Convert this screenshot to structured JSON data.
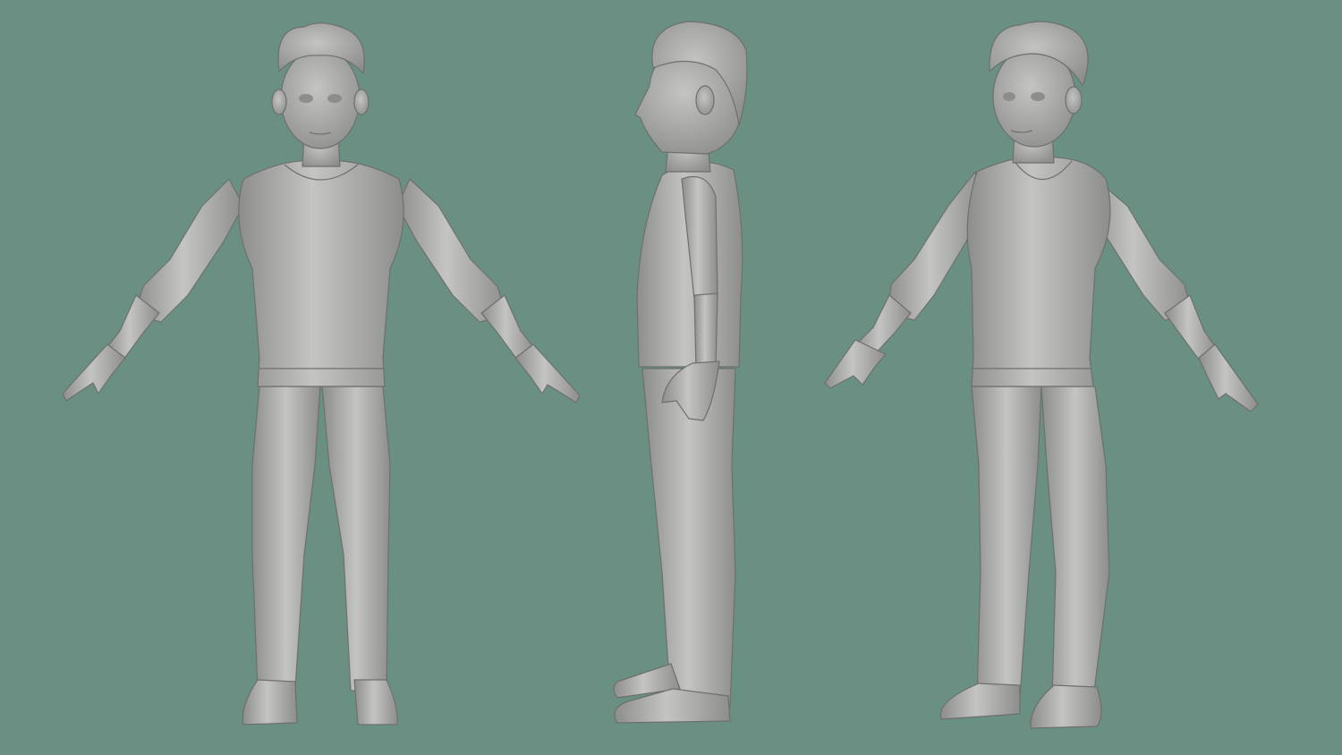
{
  "scene": {
    "background_color": "#6a9083",
    "model_color": "#a9aaa8",
    "model_shade_color": "#8d8e8c",
    "model_light_color": "#c4c5c3",
    "outline_color": "#6e706d"
  },
  "views": [
    {
      "id": "front",
      "facing": "front"
    },
    {
      "id": "side",
      "facing": "left-profile"
    },
    {
      "id": "three-quarter",
      "facing": "three-quarter-left"
    }
  ]
}
